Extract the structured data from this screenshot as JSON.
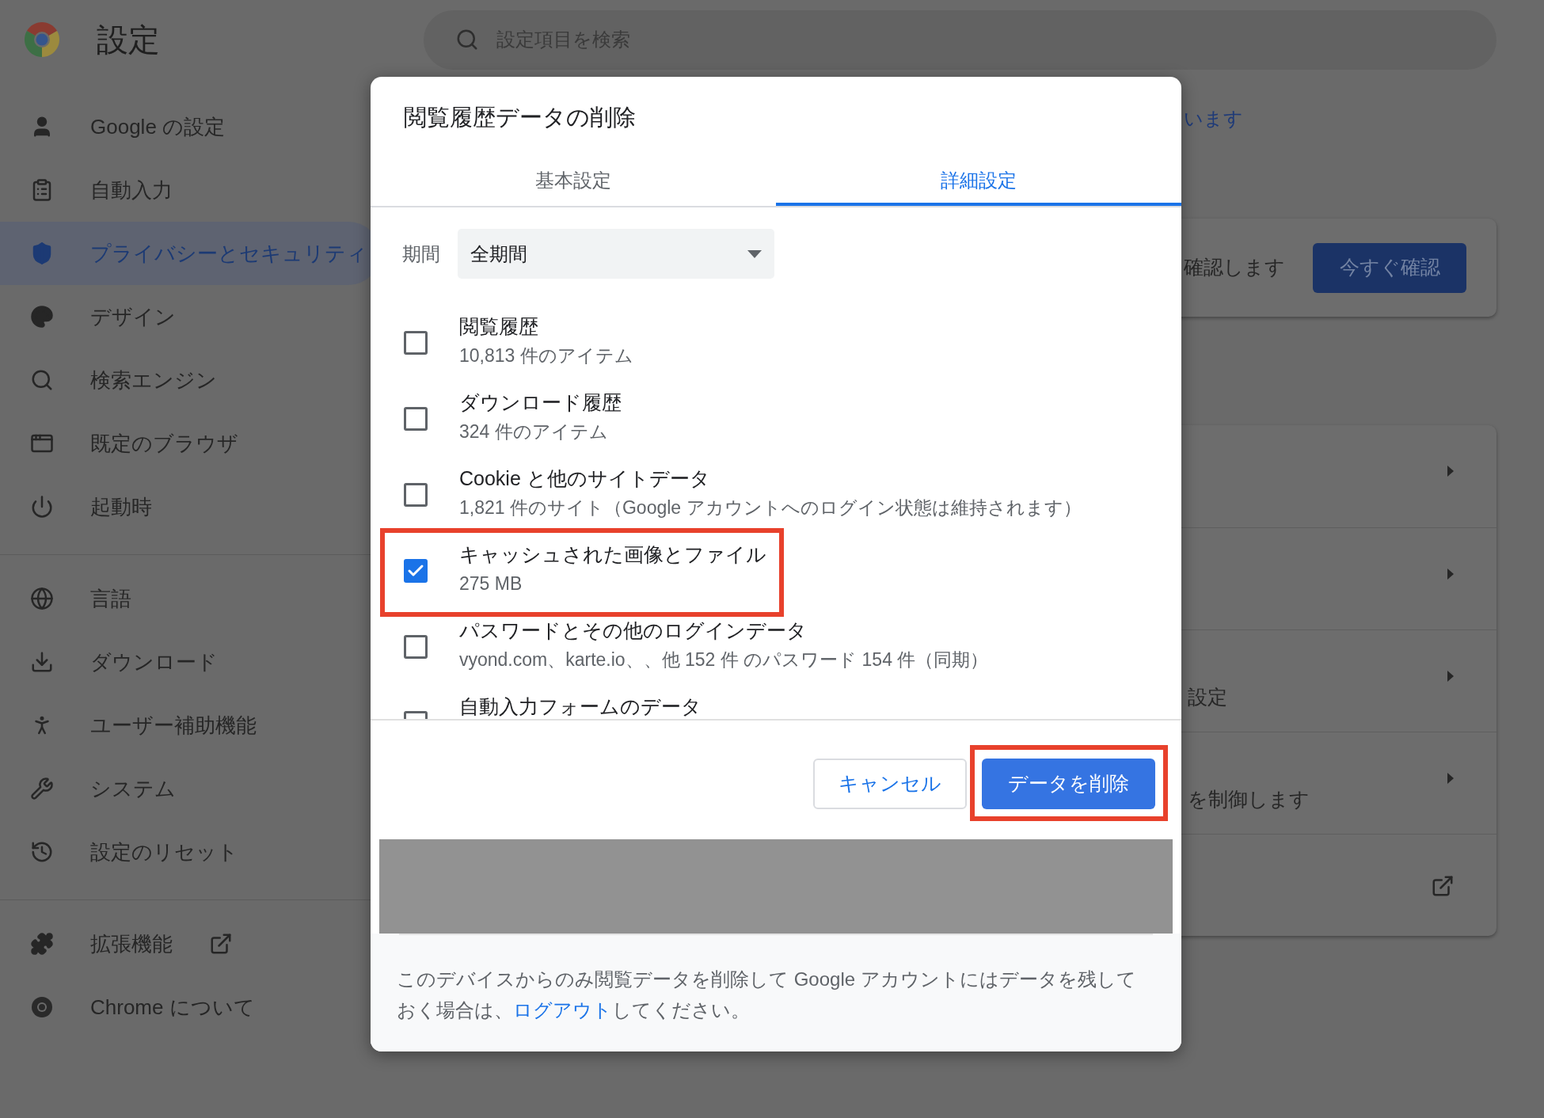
{
  "header": {
    "title": "設定",
    "search": {
      "placeholder": "設定項目を検索"
    }
  },
  "sidebar": {
    "groups": [
      [
        {
          "label": "Google の設定",
          "selected": false,
          "external": false
        },
        {
          "label": "自動入力",
          "selected": false,
          "external": false
        },
        {
          "label": "プライバシーとセキュリティ",
          "selected": true,
          "external": false
        },
        {
          "label": "デザイン",
          "selected": false,
          "external": false
        },
        {
          "label": "検索エンジン",
          "selected": false,
          "external": false
        },
        {
          "label": "既定のブラウザ",
          "selected": false,
          "external": false
        },
        {
          "label": "起動時",
          "selected": false,
          "external": false
        }
      ],
      [
        {
          "label": "言語",
          "selected": false,
          "external": false
        },
        {
          "label": "ダウンロード",
          "selected": false,
          "external": false
        },
        {
          "label": "ユーザー補助機能",
          "selected": false,
          "external": false
        },
        {
          "label": "システム",
          "selected": false,
          "external": false
        },
        {
          "label": "設定のリセット",
          "selected": false,
          "external": false
        }
      ],
      [
        {
          "label": "拡張機能",
          "selected": false,
          "external": true
        },
        {
          "label": "Chrome について",
          "selected": false,
          "external": false
        }
      ]
    ]
  },
  "background": {
    "link_text": "います",
    "safety_card": {
      "text": "確認します",
      "button": "今すぐ確認"
    },
    "rows": [
      {
        "kind": "arrow"
      },
      {
        "kind": "arrow"
      },
      {
        "kind": "arrow",
        "text": "設定"
      },
      {
        "kind": "arrow",
        "text": "を制御します"
      },
      {
        "kind": "external"
      }
    ]
  },
  "dialog": {
    "title": "閲覧履歴データの削除",
    "tabs": [
      {
        "label": "基本設定",
        "selected": false
      },
      {
        "label": "詳細設定",
        "selected": true
      }
    ],
    "period": {
      "label": "期間",
      "value": "全期間"
    },
    "items": [
      {
        "title": "閲覧履歴",
        "detail": "10,813 件のアイテム",
        "checked": false,
        "highlighted": false
      },
      {
        "title": "ダウンロード履歴",
        "detail": "324 件のアイテム",
        "checked": false,
        "highlighted": false
      },
      {
        "title": "Cookie と他のサイトデータ",
        "detail": "1,821 件のサイト（Google アカウントへのログイン状態は維持されます）",
        "checked": false,
        "highlighted": false
      },
      {
        "title": "キャッシュされた画像とファイル",
        "detail": "275 MB",
        "checked": true,
        "highlighted": true
      },
      {
        "title": "パスワードとその他のログインデータ",
        "detail": "vyond.com、karte.io、、他 152 件 のパスワード 154 件（同期）",
        "checked": false,
        "highlighted": false
      },
      {
        "title": "自動入力フォームのデータ",
        "checked": false,
        "highlighted": false
      }
    ],
    "buttons": [
      {
        "kind": "cancel",
        "label": "キャンセル",
        "highlighted": false
      },
      {
        "kind": "confirm",
        "label": "データを削除",
        "highlighted": true
      }
    ],
    "note": {
      "before": "このデバイスからのみ閲覧データを削除して Google アカウントにはデータを残しておく場合は、",
      "link": "ログアウト",
      "after": "してください。"
    }
  }
}
